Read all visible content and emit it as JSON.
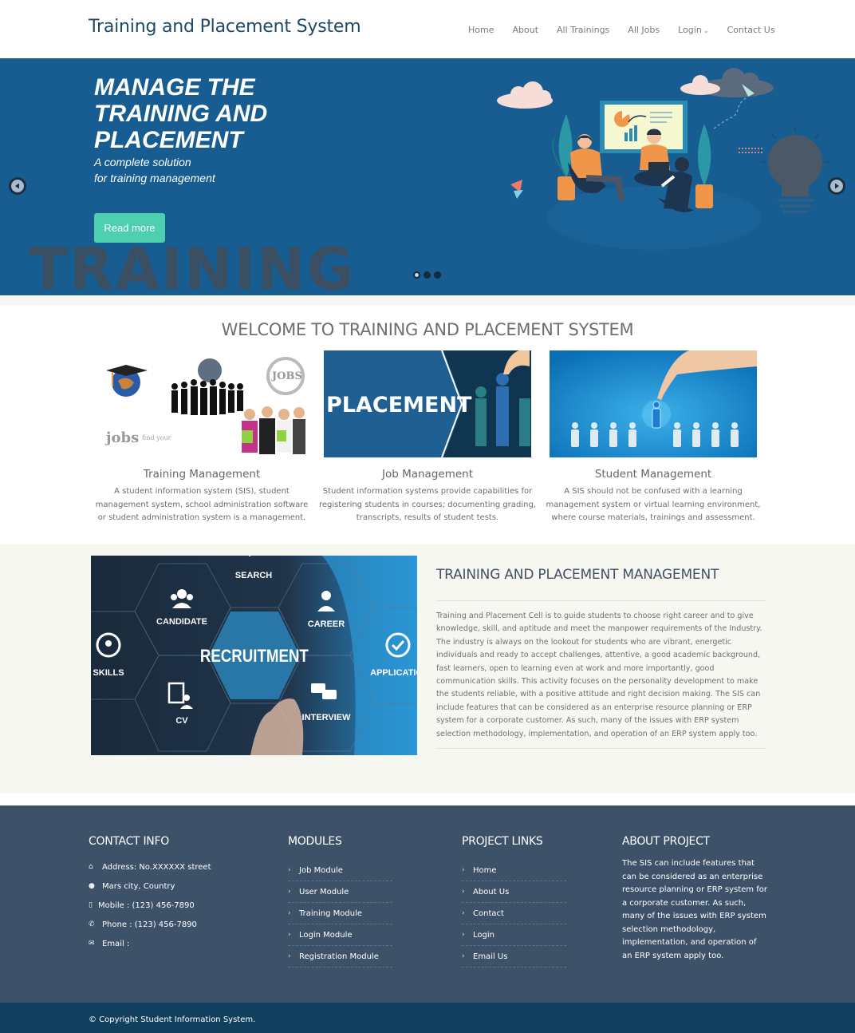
{
  "header": {
    "brand": "Training and Placement System",
    "nav": [
      {
        "label": "Home"
      },
      {
        "label": "About"
      },
      {
        "label": "All Trainings"
      },
      {
        "label": "All Jobs"
      },
      {
        "label": "Login",
        "has_dropdown": true
      },
      {
        "label": "Contact Us"
      }
    ],
    "dropdown_icon": "chevron-down-icon"
  },
  "hero": {
    "title_lines": [
      "MANAGE THE",
      "TRAINING AND",
      "PLACEMENT"
    ],
    "subtitle_lines": [
      "A complete solution",
      "for training management"
    ],
    "background_word": "TRAINING",
    "button_label": "Read more",
    "slides_total": 3,
    "active_slide": 1,
    "prev_icon": "arrow-left-icon",
    "next_icon": "arrow-right-icon",
    "colors": {
      "background": "#175d91",
      "button": "#4ecfb0"
    }
  },
  "welcome": {
    "heading": "WELCOME TO TRAINING AND PLACEMENT SYSTEM",
    "cards": [
      {
        "title": "Training Management",
        "text": "A student information system (SIS), student management system, school administration software or student administration system is a management."
      },
      {
        "title": "Job Management",
        "text": "Student information systems provide capabilities for registering students in courses; documenting grading, transcripts, results of student tests.",
        "image_text": "PLACEMENT"
      },
      {
        "title": "Student Management",
        "text": "A SIS should not be confused with a learning management system or virtual learning environment, where course materials, trainings and assessment."
      }
    ]
  },
  "about": {
    "heading": "TRAINING AND PLACEMENT MANAGEMENT",
    "paragraph": "Training and Placement Cell is to guide students to choose right career and to give knowledge, skill, and aptitude and meet the manpower requirements of the Industry. The industry is always on the lookout for students who are vibrant, energetic individuals and ready to accept challenges, attentive, a good academic background, fast learners, open to learning even at work and more importantly, good communication skills. This activity focuses on the personality development to make the students reliable, with a positive attitude and right decision making. The SIS can include features that can be considered as an enterprise resource planning or ERP system for a corporate customer. As such, many of the issues with ERP system selection methodology, implementation, and operation of an ERP system apply too.",
    "image_labels": {
      "center": "RECRUITMENT",
      "search": "SEARCH",
      "candidate": "CANDIDATE",
      "career": "CAREER",
      "skills": "SKILLS",
      "application": "APPLICATION",
      "cv": "CV",
      "interview": "INTERVIEW"
    }
  },
  "footer": {
    "contact": {
      "heading": "CONTACT INFO",
      "items": [
        {
          "icon": "home-icon",
          "text": "Address: No.XXXXXX street"
        },
        {
          "icon": "globe-icon",
          "text": "Mars city, Country"
        },
        {
          "icon": "mobile-icon",
          "text": "Mobile : (123) 456-7890"
        },
        {
          "icon": "phone-icon",
          "text": "Phone : (123) 456-7890"
        },
        {
          "icon": "envelope-icon",
          "text": "Email :"
        }
      ]
    },
    "modules": {
      "heading": "MODULES",
      "links": [
        "Job Module",
        "User Module",
        "Training Module",
        "Login Module",
        "Registration Module"
      ]
    },
    "project_links": {
      "heading": "PROJECT LINKS",
      "links": [
        "Home",
        "About Us",
        "Contact",
        "Login",
        "Email Us"
      ]
    },
    "about_project": {
      "heading": "ABOUT PROJECT",
      "text": "The SIS can include features that can be considered as an enterprise resource planning or ERP system for a corporate customer. As such, many of the issues with ERP system selection methodology, implementation, and operation of an ERP system apply too."
    },
    "copyright": "© Copyright Student Information System."
  }
}
